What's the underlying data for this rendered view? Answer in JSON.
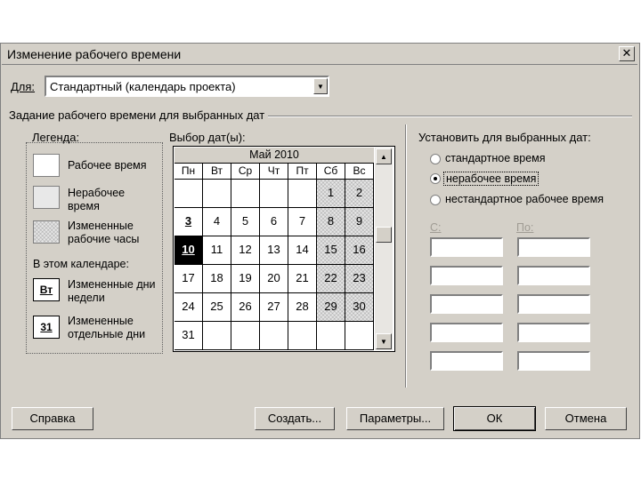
{
  "dialog": {
    "title": "Изменение рабочего времени",
    "close_glyph": "✕"
  },
  "for_field": {
    "label": "Для:",
    "value": "Стандартный (календарь проекта)",
    "dropdown_glyph": "▼"
  },
  "group_title": "Задание рабочего времени для выбранных дат",
  "legend": {
    "title": "Легенда:",
    "working": "Рабочее время",
    "nonworking": "Нерабочее время",
    "changed_hours": "Измененные рабочие часы",
    "in_calendar": "В этом календаре:",
    "weekday_badge": "Вт",
    "changed_weekdays": "Измененные дни недели",
    "day_badge": "31",
    "changed_days": "Измененные отдельные дни"
  },
  "calendar": {
    "label": "Выбор дат(ы):",
    "month": "Май 2010",
    "weekdays": [
      "Пн",
      "Вт",
      "Ср",
      "Чт",
      "Пт",
      "Сб",
      "Вс"
    ],
    "weeks": [
      [
        "",
        "",
        "",
        "",
        "",
        "1",
        "2"
      ],
      [
        "3",
        "4",
        "5",
        "6",
        "7",
        "8",
        "9"
      ],
      [
        "10",
        "11",
        "12",
        "13",
        "14",
        "15",
        "16"
      ],
      [
        "17",
        "18",
        "19",
        "20",
        "21",
        "22",
        "23"
      ],
      [
        "24",
        "25",
        "26",
        "27",
        "28",
        "29",
        "30"
      ],
      [
        "31",
        "",
        "",
        "",
        "",
        "",
        ""
      ]
    ],
    "selected_day": "10",
    "scroll_up_glyph": "▲",
    "scroll_down_glyph": "▼"
  },
  "set_dates": {
    "title": "Установить для выбранных дат:",
    "options": [
      "стандартное время",
      "нерабочее время",
      "нестандартное рабочее время"
    ],
    "selected_index": 1,
    "from_label": "С:",
    "to_label": "По:"
  },
  "buttons": {
    "help": "Справка",
    "new": "Создать...",
    "options": "Параметры...",
    "ok": "ОК",
    "cancel": "Отмена"
  }
}
